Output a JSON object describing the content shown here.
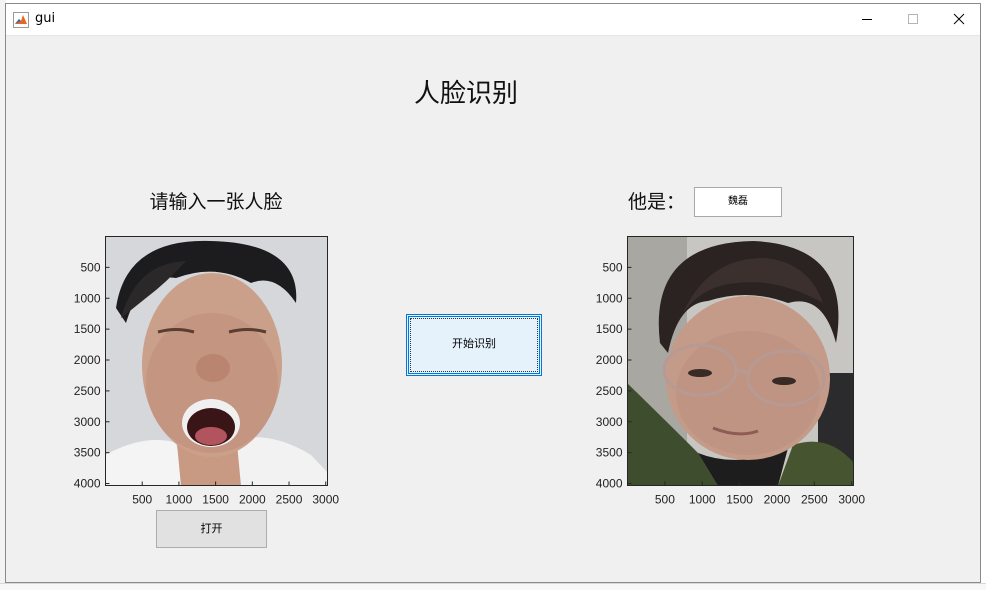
{
  "window": {
    "title": "gui",
    "minimize_icon": "minimize-icon",
    "maximize_icon": "maximize-icon",
    "close_icon": "close-icon"
  },
  "header": {
    "title": "人脸识别"
  },
  "left_panel": {
    "label": "请输入一张人脸",
    "open_button": "打开",
    "axes": {
      "x_ticks": [
        "500",
        "1000",
        "1500",
        "2000",
        "2500",
        "3000"
      ],
      "y_ticks": [
        "500",
        "1000",
        "1500",
        "2000",
        "2500",
        "3000",
        "3500",
        "4000"
      ]
    }
  },
  "center": {
    "start_button": "开始识别"
  },
  "right_panel": {
    "label": "他是：",
    "result_text": "魏磊",
    "axes": {
      "x_ticks": [
        "500",
        "1000",
        "1500",
        "2000",
        "2500",
        "3000"
      ],
      "y_ticks": [
        "500",
        "1000",
        "1500",
        "2000",
        "2500",
        "3000",
        "3500",
        "4000"
      ]
    }
  }
}
